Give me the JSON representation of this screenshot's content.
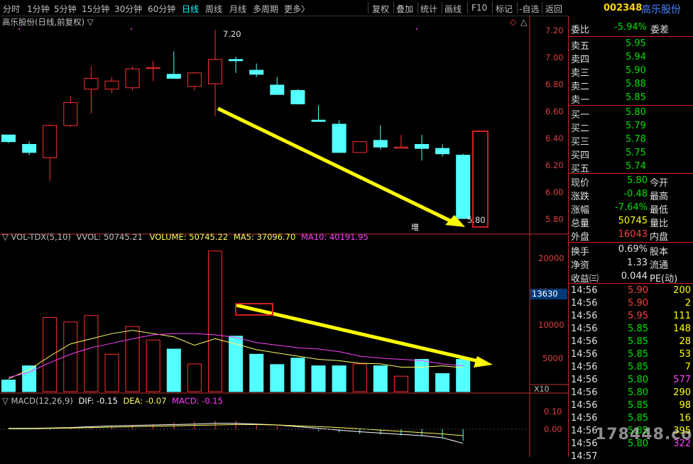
{
  "toolbar": {
    "items": [
      "分时",
      "1分钟",
      "5分钟",
      "15分钟",
      "30分钟",
      "60分钟",
      "日线",
      "周线",
      "月线",
      "多周期",
      "更多〉"
    ],
    "active_index": 6,
    "right_items": [
      "复权",
      "叠加",
      "统计",
      "画线",
      "F10",
      "标记",
      "-自选",
      "返回"
    ]
  },
  "stock": {
    "code": "002348",
    "name": "高乐股份"
  },
  "main_chart": {
    "title": "高乐股份(日线,前复权)",
    "high_marker": "7.20",
    "low_marker": "5.80",
    "zeng_label": "增",
    "y_ticks": [
      "7.20",
      "7.00",
      "6.80",
      "6.60",
      "6.40",
      "6.20",
      "6.00",
      "5.80"
    ]
  },
  "vol_chart": {
    "name": "VOL-TDX(5,10)",
    "vvol": "VVOL: 50745.21",
    "volume": "VOLUME: 50745.22",
    "ma5": "MA5: 37096.70",
    "ma10": "MA10: 40191.95",
    "y_ticks": [
      "20000",
      "15000",
      "10000",
      "5000"
    ],
    "current_box": "13630",
    "unit": "X10"
  },
  "macd_chart": {
    "name": "MACD(12,26,9)",
    "dif": "DIF: -0.15",
    "dea": "DEA: -0.07",
    "macd": "MACD: -0.15",
    "y_ticks": [
      "0.10",
      "0.00"
    ]
  },
  "colors": {
    "up": "#ff3030",
    "down": "#54ffff",
    "ma5": "#ffff60",
    "ma10": "#ff40ff",
    "arrow": "#ffff00",
    "border": "#d02020"
  },
  "quote": {
    "weibi_label": "委比",
    "weibi_value": "-5.94%",
    "weicha_label": "委差",
    "sell": [
      {
        "label": "卖五",
        "price": "5.95"
      },
      {
        "label": "卖四",
        "price": "5.94"
      },
      {
        "label": "卖三",
        "price": "5.90"
      },
      {
        "label": "卖二",
        "price": "5.88"
      },
      {
        "label": "卖一",
        "price": "5.85"
      }
    ],
    "buy": [
      {
        "label": "买一",
        "price": "5.80"
      },
      {
        "label": "买二",
        "price": "5.79"
      },
      {
        "label": "买三",
        "price": "5.78"
      },
      {
        "label": "买四",
        "price": "5.75"
      },
      {
        "label": "买五",
        "price": "5.74"
      }
    ],
    "stats1": [
      {
        "l": "现价",
        "v": "5.80",
        "r": "今开"
      },
      {
        "l": "涨跌",
        "v": "-0.48",
        "r": "最高"
      },
      {
        "l": "涨幅",
        "v": "-7.64%",
        "r": "最低"
      },
      {
        "l": "总量",
        "v": "50745",
        "r": "量比"
      },
      {
        "l": "外盘",
        "v": "16043",
        "r": "内盘"
      }
    ],
    "stats2": [
      {
        "l": "换手",
        "v": "0.69%",
        "r": "股本"
      },
      {
        "l": "净资",
        "v": "1.33",
        "r": "流通"
      },
      {
        "l": "收益㈢",
        "v": "0.044",
        "r": "PE(动)"
      }
    ],
    "ticks": [
      {
        "t": "14:56",
        "p": "5.90",
        "v": "200"
      },
      {
        "t": "14:56",
        "p": "5.90",
        "v": "2"
      },
      {
        "t": "14:56",
        "p": "5.95",
        "v": "111"
      },
      {
        "t": "14:56",
        "p": "5.85",
        "v": "148"
      },
      {
        "t": "14:56",
        "p": "5.85",
        "v": "28"
      },
      {
        "t": "14:56",
        "p": "5.85",
        "v": "53"
      },
      {
        "t": "14:56",
        "p": "5.85",
        "v": "7"
      },
      {
        "t": "14:56",
        "p": "5.80",
        "v": "577"
      },
      {
        "t": "14:56",
        "p": "5.80",
        "v": "290"
      },
      {
        "t": "14:56",
        "p": "5.85",
        "v": "98"
      },
      {
        "t": "14:56",
        "p": "5.85",
        "v": "16"
      },
      {
        "t": "14:56",
        "p": "5.85",
        "v": "395"
      },
      {
        "t": "14:56",
        "p": "5.80",
        "v": "322"
      },
      {
        "t": "14:57",
        "p": "",
        "v": ""
      }
    ]
  },
  "watermark": "178448.com",
  "chart_data": {
    "type": "candlestick",
    "title": "高乐股份(日线,前复权)",
    "ohlc": [
      [
        6.42,
        6.42,
        6.36,
        6.37
      ],
      [
        6.35,
        6.37,
        6.27,
        6.29
      ],
      [
        6.25,
        6.5,
        6.08,
        6.49
      ],
      [
        6.49,
        6.71,
        6.48,
        6.66
      ],
      [
        6.76,
        6.93,
        6.58,
        6.84
      ],
      [
        6.76,
        6.85,
        6.73,
        6.82
      ],
      [
        6.77,
        6.93,
        6.75,
        6.91
      ],
      [
        6.92,
        6.97,
        6.82,
        6.92
      ],
      [
        6.87,
        7.04,
        6.84,
        6.84
      ],
      [
        6.78,
        6.89,
        6.75,
        6.88
      ],
      [
        6.8,
        7.2,
        6.56,
        6.98
      ],
      [
        6.98,
        7.0,
        6.88,
        6.97
      ],
      [
        6.9,
        6.95,
        6.85,
        6.87
      ],
      [
        6.79,
        6.85,
        6.72,
        6.72
      ],
      [
        6.75,
        6.76,
        6.65,
        6.65
      ],
      [
        6.53,
        6.64,
        6.52,
        6.52
      ],
      [
        6.5,
        6.53,
        6.31,
        6.29
      ],
      [
        6.29,
        6.37,
        6.29,
        6.37
      ],
      [
        6.38,
        6.49,
        6.31,
        6.33
      ],
      [
        6.33,
        6.42,
        6.33,
        6.33
      ],
      [
        6.35,
        6.42,
        6.23,
        6.32
      ],
      [
        6.32,
        6.35,
        6.26,
        6.28
      ],
      [
        6.27,
        6.28,
        5.8,
        5.8
      ]
    ],
    "volume": [
      18,
      40,
      115,
      108,
      118,
      58,
      101,
      80,
      66,
      43,
      218,
      86,
      58,
      42,
      52,
      40,
      40,
      43,
      40,
      24,
      50,
      28,
      50
    ],
    "volume_unit": "X10",
    "ma5": [
      20,
      34,
      55,
      74,
      82,
      90,
      95,
      90,
      85,
      72,
      82,
      74,
      65,
      60,
      55,
      50,
      48,
      44,
      43,
      38,
      38,
      40,
      37
    ],
    "ma10": [
      22,
      30,
      45,
      58,
      68,
      75,
      82,
      88,
      90,
      90,
      88,
      84,
      76,
      72,
      68,
      66,
      62,
      55,
      52,
      50,
      48,
      43,
      40
    ],
    "ylim": [
      5.75,
      7.3
    ],
    "vol_ylim": [
      0,
      230
    ]
  }
}
